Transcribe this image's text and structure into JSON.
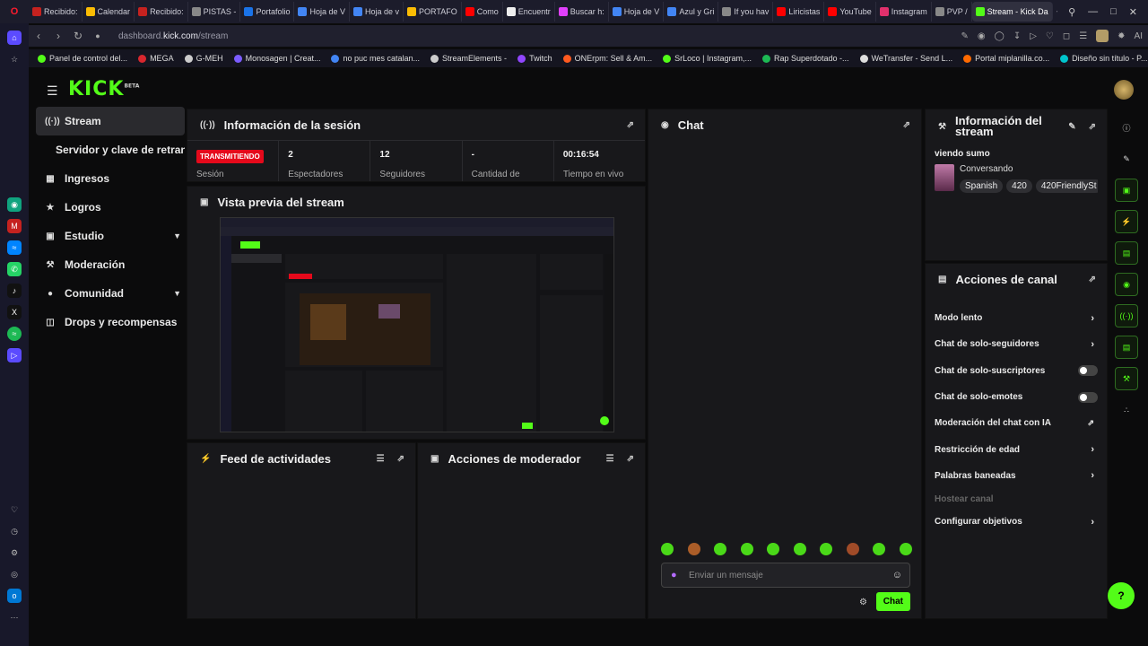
{
  "browser": {
    "tabs": [
      {
        "label": "Recibido:",
        "color": "#c5221f"
      },
      {
        "label": "Calendar",
        "color": "#fbbc04"
      },
      {
        "label": "Recibido:",
        "color": "#c5221f"
      },
      {
        "label": "PISTAS -",
        "color": "#888888"
      },
      {
        "label": "Portafolio",
        "color": "#1a73e8"
      },
      {
        "label": "Hoja de V",
        "color": "#4285f4"
      },
      {
        "label": "Hoja de v",
        "color": "#4285f4"
      },
      {
        "label": "PORTAFO",
        "color": "#fbbc04"
      },
      {
        "label": "Como",
        "color": "#ff0000"
      },
      {
        "label": "Encuentr",
        "color": "#eeeeee"
      },
      {
        "label": "Buscar h:",
        "color": "#e040fb"
      },
      {
        "label": "Hoja de V",
        "color": "#4285f4"
      },
      {
        "label": "Azul y Gri",
        "color": "#4285f4"
      },
      {
        "label": "If you hav",
        "color": "#888888"
      },
      {
        "label": "Liricistas",
        "color": "#ff0000"
      },
      {
        "label": "YouTube",
        "color": "#ff0000"
      },
      {
        "label": "Instagram",
        "color": "#e1306c"
      },
      {
        "label": "PVP /",
        "color": "#888888"
      },
      {
        "label": "Stream - Kick Da",
        "color": "#53fc18",
        "active": true
      }
    ],
    "url_prefix": "dashboard.",
    "url_domain": "kick.com",
    "url_path": "/stream",
    "ai_label": "AI",
    "bookmarks": [
      {
        "label": "Panel de control del...",
        "color": "#53fc18"
      },
      {
        "label": "MEGA",
        "color": "#d9272e"
      },
      {
        "label": "G-MEH",
        "color": "#cccccc"
      },
      {
        "label": "Monosagen | Creat...",
        "color": "#7b5cff"
      },
      {
        "label": "no puc mes catalan...",
        "color": "#4285f4"
      },
      {
        "label": "StreamElements -",
        "color": "#cccccc"
      },
      {
        "label": "Twitch",
        "color": "#9146ff"
      },
      {
        "label": "ONErpm: Sell & Am...",
        "color": "#ff5a1f"
      },
      {
        "label": "SrLoco | Instagram,...",
        "color": "#53fc18"
      },
      {
        "label": "Rap Superdotado -...",
        "color": "#1db954"
      },
      {
        "label": "WeTransfer - Send L...",
        "color": "#dddddd"
      },
      {
        "label": "Portal miplanilla.co...",
        "color": "#ff6a00"
      },
      {
        "label": "Diseño sin título - P...",
        "color": "#00c4cc"
      }
    ]
  },
  "kick": {
    "logo": "KICK",
    "logo_beta": "BETA",
    "nav": {
      "stream": "Stream",
      "server_key": "Servidor y clave de retransmisión",
      "income": "Ingresos",
      "achievements": "Logros",
      "studio": "Estudio",
      "moderation": "Moderación",
      "community": "Comunidad",
      "drops": "Drops y recompensas"
    },
    "session": {
      "title": "Información de la sesión",
      "status": "TRANSMITIENDO",
      "status_label": "Sesión",
      "viewers": "2",
      "viewers_label": "Espectadores",
      "followers": "12",
      "followers_label": "Seguidores",
      "amount": "-",
      "amount_label": "Cantidad de",
      "live_time": "00:16:54",
      "live_time_label": "Tiempo en vivo"
    },
    "preview": {
      "title": "Vista previa del stream"
    },
    "activity": {
      "title": "Feed de actividades"
    },
    "moderator": {
      "title": "Acciones de moderador"
    },
    "chat": {
      "title": "Chat",
      "placeholder": "Enviar un mensaje",
      "send": "Chat"
    },
    "stream_info": {
      "title": "Información del stream",
      "stream_title": "viendo sumo",
      "category": "Conversando",
      "tags": [
        "Spanish",
        "420",
        "420FriendlySt"
      ]
    },
    "channel_actions": {
      "title": "Acciones de canal",
      "items": [
        "Modo lento",
        "Chat de solo-seguidores",
        "Chat de solo-suscriptores",
        "Chat de solo-emotes",
        "Moderación del chat con IA",
        "Restricción de edad",
        "Palabras baneadas",
        "Hostear canal",
        "Configurar objetivos"
      ]
    }
  },
  "colors": {
    "accent": "#53fc18",
    "live": "#e5091b"
  }
}
